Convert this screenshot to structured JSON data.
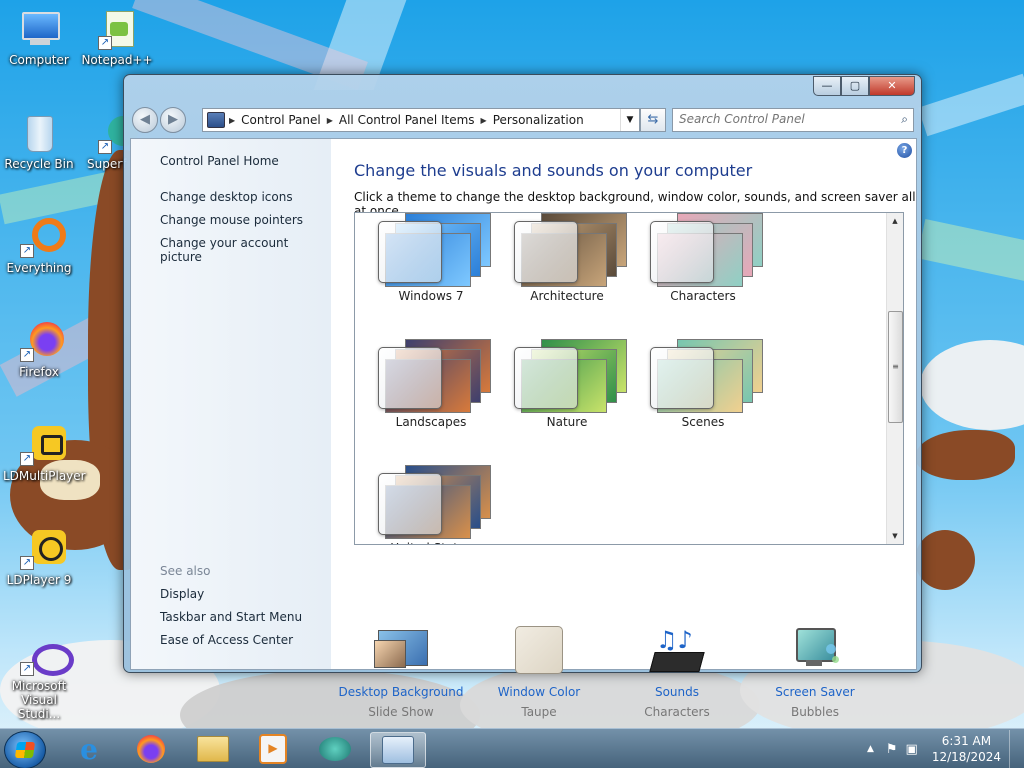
{
  "desktop": {
    "icons": [
      {
        "label": "Computer",
        "icon": "computer-icon"
      },
      {
        "label": "Notepad++",
        "icon": "notepad-plus-plus-icon"
      },
      {
        "label": "Recycle Bin",
        "icon": "recycle-bin-icon"
      },
      {
        "label": "Superf",
        "icon": "superf-icon"
      },
      {
        "label": "Everything",
        "icon": "everything-icon"
      },
      {
        "label": "Firefox",
        "icon": "firefox-icon"
      },
      {
        "label": "LDMultiPlayer",
        "icon": "ldmultiplayer-icon"
      },
      {
        "label": "LDPlayer 9",
        "icon": "ldplayer-icon"
      },
      {
        "label": "Microsoft Visual Studi...",
        "icon": "visual-studio-icon"
      }
    ]
  },
  "window": {
    "controls": {
      "minimize": "—",
      "maximize": "▢",
      "close": "✕"
    },
    "breadcrumb": [
      "Control Panel",
      "All Control Panel Items",
      "Personalization"
    ],
    "search_placeholder": "Search Control Panel",
    "sidebar": {
      "home": "Control Panel Home",
      "links": [
        "Change desktop icons",
        "Change mouse pointers",
        "Change your account picture"
      ],
      "see_also_label": "See also",
      "see_also": [
        "Display",
        "Taskbar and Start Menu",
        "Ease of Access Center"
      ]
    },
    "main": {
      "title": "Change the visuals and sounds on your computer",
      "subtitle": "Click a theme to change the desktop background, window color, sounds, and screen saver all at once.",
      "themes": [
        {
          "name": "Windows 7",
          "colors": [
            "#2b7fd8",
            "#7ec8ff"
          ]
        },
        {
          "name": "Architecture",
          "colors": [
            "#5a4a3a",
            "#c8a57a"
          ]
        },
        {
          "name": "Characters",
          "colors": [
            "#e8a7b8",
            "#8fd0c4"
          ]
        },
        {
          "name": "Landscapes",
          "colors": [
            "#3d3f6e",
            "#d87a3b"
          ]
        },
        {
          "name": "Nature",
          "colors": [
            "#2f8f4a",
            "#c9e36a"
          ]
        },
        {
          "name": "Scenes",
          "colors": [
            "#76c6b0",
            "#f1d08f"
          ]
        },
        {
          "name": "United States",
          "colors": [
            "#284e8a",
            "#d9904a"
          ]
        }
      ],
      "bottom": [
        {
          "label": "Desktop Background",
          "value": "Slide Show",
          "icon": "desktop-background-icon"
        },
        {
          "label": "Window Color",
          "value": "Taupe",
          "icon": "window-color-icon",
          "color": "#ddd5c4"
        },
        {
          "label": "Sounds",
          "value": "Characters",
          "icon": "sounds-icon"
        },
        {
          "label": "Screen Saver",
          "value": "Bubbles",
          "icon": "screen-saver-icon"
        }
      ]
    }
  },
  "taskbar": {
    "items": [
      "internet-explorer-icon",
      "firefox-icon",
      "file-explorer-icon",
      "media-player-icon",
      "app-icon",
      "control-panel-icon"
    ],
    "time": "6:31 AM",
    "date": "12/18/2024"
  }
}
